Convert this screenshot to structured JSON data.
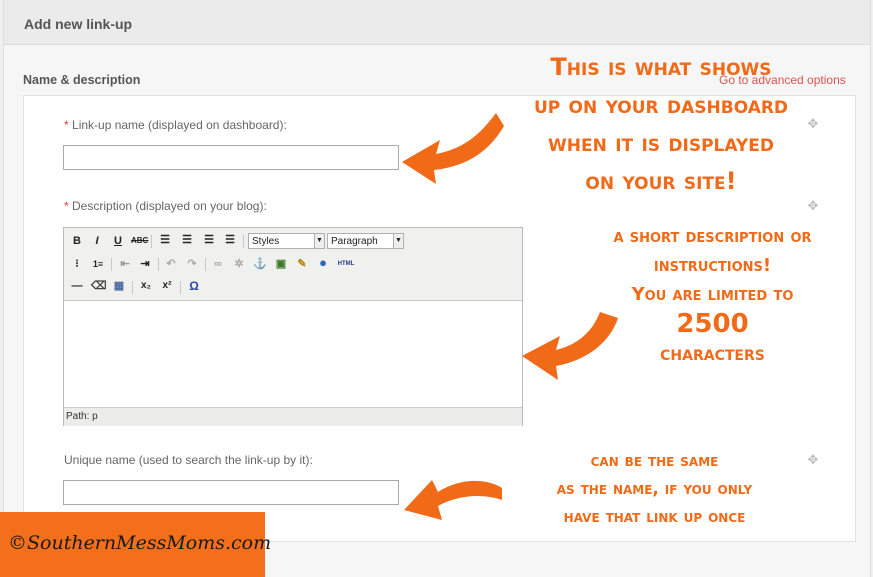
{
  "header": {
    "title": "Add new link-up"
  },
  "section": {
    "title": "Name & description",
    "advanced_link": "Go to advanced options"
  },
  "fields": {
    "name": {
      "required_mark": "*",
      "label": "Link-up name (displayed on dashboard):",
      "value": ""
    },
    "description": {
      "required_mark": "*",
      "label": "Description (displayed on your blog):"
    },
    "unique": {
      "label": "Unique name (used to search the link-up by it):",
      "value": ""
    }
  },
  "editor": {
    "toolbar_row1": [
      "bold-icon",
      "italic-icon",
      "underline-icon",
      "strikethrough-icon",
      "align-left-icon",
      "align-center-icon",
      "align-right-icon",
      "align-justify-icon"
    ],
    "styles_select": "Styles",
    "format_select": "Paragraph",
    "toolbar_row2": [
      "bullet-list-icon",
      "numbered-list-icon",
      "outdent-icon",
      "indent-icon",
      "undo-icon",
      "redo-icon",
      "link-icon",
      "unlink-icon",
      "anchor-icon",
      "image-icon",
      "cleanup-icon",
      "help-icon",
      "html-icon"
    ],
    "html_label": "HTML",
    "toolbar_row3": [
      "horizontal-rule-icon",
      "eraser-icon",
      "table-icon",
      "subscript-icon",
      "superscript-icon",
      "special-char-icon"
    ],
    "path": "Path: p"
  },
  "annotations": {
    "note1": [
      "This is what shows",
      "up on your dashboard",
      "when it is displayed",
      "on your site!"
    ],
    "note2": [
      "a short description or",
      "instructions!",
      "You are limited to",
      "2500",
      "characters"
    ],
    "note3": [
      "can be the same",
      "as the name, if you only",
      "have that link up once"
    ]
  },
  "watermark": "©SouthernMessMoms.com",
  "colors": {
    "annotation": "#f06a18",
    "watermark_bg": "#f36f1b",
    "required": "#e0412d"
  }
}
